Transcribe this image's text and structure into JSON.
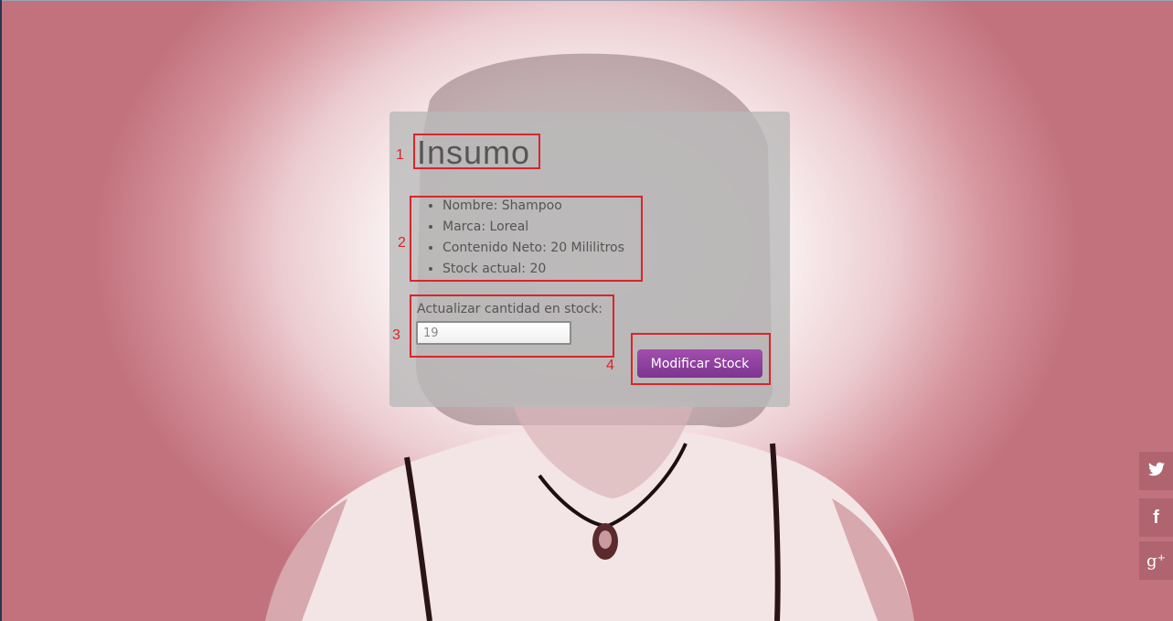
{
  "card": {
    "title": "Insumo",
    "details": [
      "Nombre: Shampoo",
      "Marca: Loreal",
      "Contenido Neto: 20 Mililitros",
      "Stock actual: 20"
    ],
    "stock_field": {
      "label": "Actualizar cantidad en stock:",
      "value": "19"
    },
    "submit_label": "Modificar Stock"
  },
  "annotations": [
    "1",
    "2",
    "3",
    "4"
  ],
  "social": {
    "twitter_glyph": "🐦",
    "facebook_glyph": "f",
    "googleplus_glyph": "g⁺"
  },
  "colors": {
    "accent": "#8b3d9c",
    "annotation": "#d8262b",
    "card_bg": "#b9b9b9"
  }
}
